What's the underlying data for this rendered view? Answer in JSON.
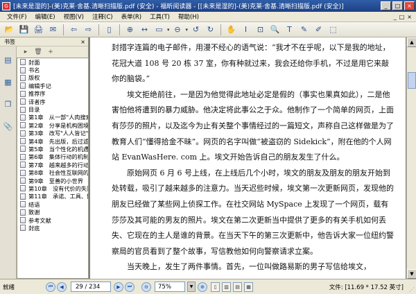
{
  "window": {
    "title": "[未来是湿的]-(美)克莱·舍基.清晰扫描版.pdf (安全) - 福昕阅读器 - [[未来是湿的]-(美)克莱·舍基.清晰扫描版.pdf (安全)]",
    "app_icon_glyph": "G",
    "minimize": "_",
    "maximize": "□",
    "close": "×"
  },
  "menu": {
    "items": [
      "文件(F)",
      "编辑(E)",
      "视图(V)",
      "注释(C)",
      "表单(R)",
      "工具(T)",
      "帮助(H)"
    ],
    "right_controls": [
      "_",
      "□",
      "×"
    ]
  },
  "toolbar": {
    "buttons": [
      {
        "name": "open-icon",
        "glyph": "📂"
      },
      {
        "name": "save-icon",
        "glyph": "💾"
      },
      {
        "name": "print-icon",
        "glyph": "🖨"
      },
      {
        "name": "email-icon",
        "glyph": "✉"
      },
      {
        "name": "back-icon",
        "glyph": "⇦"
      },
      {
        "name": "forward-icon",
        "glyph": "⇨"
      },
      {
        "name": "page-icon",
        "glyph": "▯"
      },
      {
        "name": "zoom-in-icon",
        "glyph": "⊕"
      },
      {
        "name": "fit-width-icon",
        "glyph": "↔"
      },
      {
        "name": "fit-page-icon",
        "glyph": "▭"
      },
      {
        "name": "zoom-out-icon",
        "glyph": "⊖"
      },
      {
        "name": "rotate-left-icon",
        "glyph": "↺"
      },
      {
        "name": "rotate-right-icon",
        "glyph": "↻"
      },
      {
        "name": "hand-tool-icon",
        "glyph": "✋"
      },
      {
        "name": "select-text-icon",
        "glyph": "I"
      },
      {
        "name": "snapshot-icon",
        "glyph": "⊡"
      },
      {
        "name": "find-icon",
        "glyph": "🔍"
      },
      {
        "name": "typewriter-icon",
        "glyph": "T"
      },
      {
        "name": "note-icon",
        "glyph": "✎"
      },
      {
        "name": "highlight-icon",
        "glyph": "✐"
      },
      {
        "name": "stamp-icon",
        "glyph": "⬚"
      }
    ],
    "dropdown_glyph": "▾"
  },
  "left_panel": {
    "title": "书签",
    "close": "×",
    "side_tabs": [
      {
        "name": "bookmarks-tab-icon",
        "glyph": "▤"
      },
      {
        "name": "pages-tab-icon",
        "glyph": "▦"
      },
      {
        "name": "layers-tab-icon",
        "glyph": "❐"
      },
      {
        "name": "attachments-tab-icon",
        "glyph": "📎"
      }
    ],
    "bm_tools": [
      {
        "name": "bookmark-expand-icon",
        "glyph": "▸"
      },
      {
        "name": "bookmark-delete-icon",
        "glyph": "🗑"
      },
      {
        "name": "bookmark-add-icon",
        "glyph": "+"
      }
    ],
    "bookmarks": [
      "封面",
      "书名",
      "版权",
      "编辑手记",
      "推荐序",
      "译者序",
      "目录",
      "第1章　从一部\"人肉搜索",
      "第2章　分享是机构困境的",
      "第3章　改写\"人人皆记\"的",
      "第4章　先出版，后过滤的",
      "第5章　当个性化的机遇",
      "第6章　集体行动的机制发",
      "第7章　越来越多的行动",
      "第8章　社会性互联网的",
      "第9章　至善的小世界",
      "第10章　没有代价的失败",
      "第11章　承诺、工具、协",
      "结语",
      "致谢",
      "参考文献",
      "封底"
    ]
  },
  "document": {
    "paragraphs": [
      {
        "indent": false,
        "text": "封措字连篇的电子邮件，用漫不经心的语气说：“我才不在乎呢，以下是我的地址，花冠大道 108 号 20 栋 37 室，你有种就过来，我会还给你手机，不过是用它来敲你的脑袋。”"
      },
      {
        "indent": true,
        "text": "埃文拒绝前往，一是因为他觉得此地址必定是假的（事实也果真如此），二是他害怕他将遭到的暴力威胁。他决定将此事公之于众。他制作了一个简单的网页，上面有莎莎的照片，以及迄今为止有关整个事情经过的一篇短文，声称自己这样做是为了教育人们“懂得拾金不昧”。网页的名字叫做“被盗窃的 Sidekick”，附在他的个人网站 EvanWasHere. com 上。埃文开始告诉自己的朋友发生了什么。"
      },
      {
        "indent": true,
        "text": "原始网页 6 月 6 号上线，在上线后几个小时，埃文的朋友及朋友的朋友开始到处转载，吸引了越来越多的注意力。当天迟些时候，埃文第一次更新网页，发现他的朋友已经做了某些网上侦探工作。在社交网站 MySpace 上发现了一个网页，载有莎莎及其可能的男友的照片。埃文在第二次更新当中提供了更多的有关手机如何丢失、它现在的主人是谁的背景。在当天下午的第三次更新中，他告诉大家一位纽约警察局的官员看到了整个故事，写信教他如何向警察请求立案。"
      },
      {
        "indent": true,
        "text": "当天晚上，发生了两件事情。首先，一位叫做路易斯的男子写信给埃文，"
      }
    ],
    "scroll_up": "▲",
    "scroll_down": "▼",
    "scroll_fraction": 0.12
  },
  "status": {
    "ready": "就绪",
    "first_page": "⏮",
    "prev_page": "◀",
    "page_display": "29 / 234",
    "next_page": "▶",
    "last_page": "⏭",
    "zoom_out": "⊖",
    "zoom_value": "75%",
    "zoom_drop": "▼",
    "zoom_in": "⊕",
    "layout_buttons": [
      "▯",
      "▥",
      "▤",
      "▦"
    ],
    "page_size": "文件: [11.69 * 17.52 英寸]",
    "grip": "⋰"
  }
}
